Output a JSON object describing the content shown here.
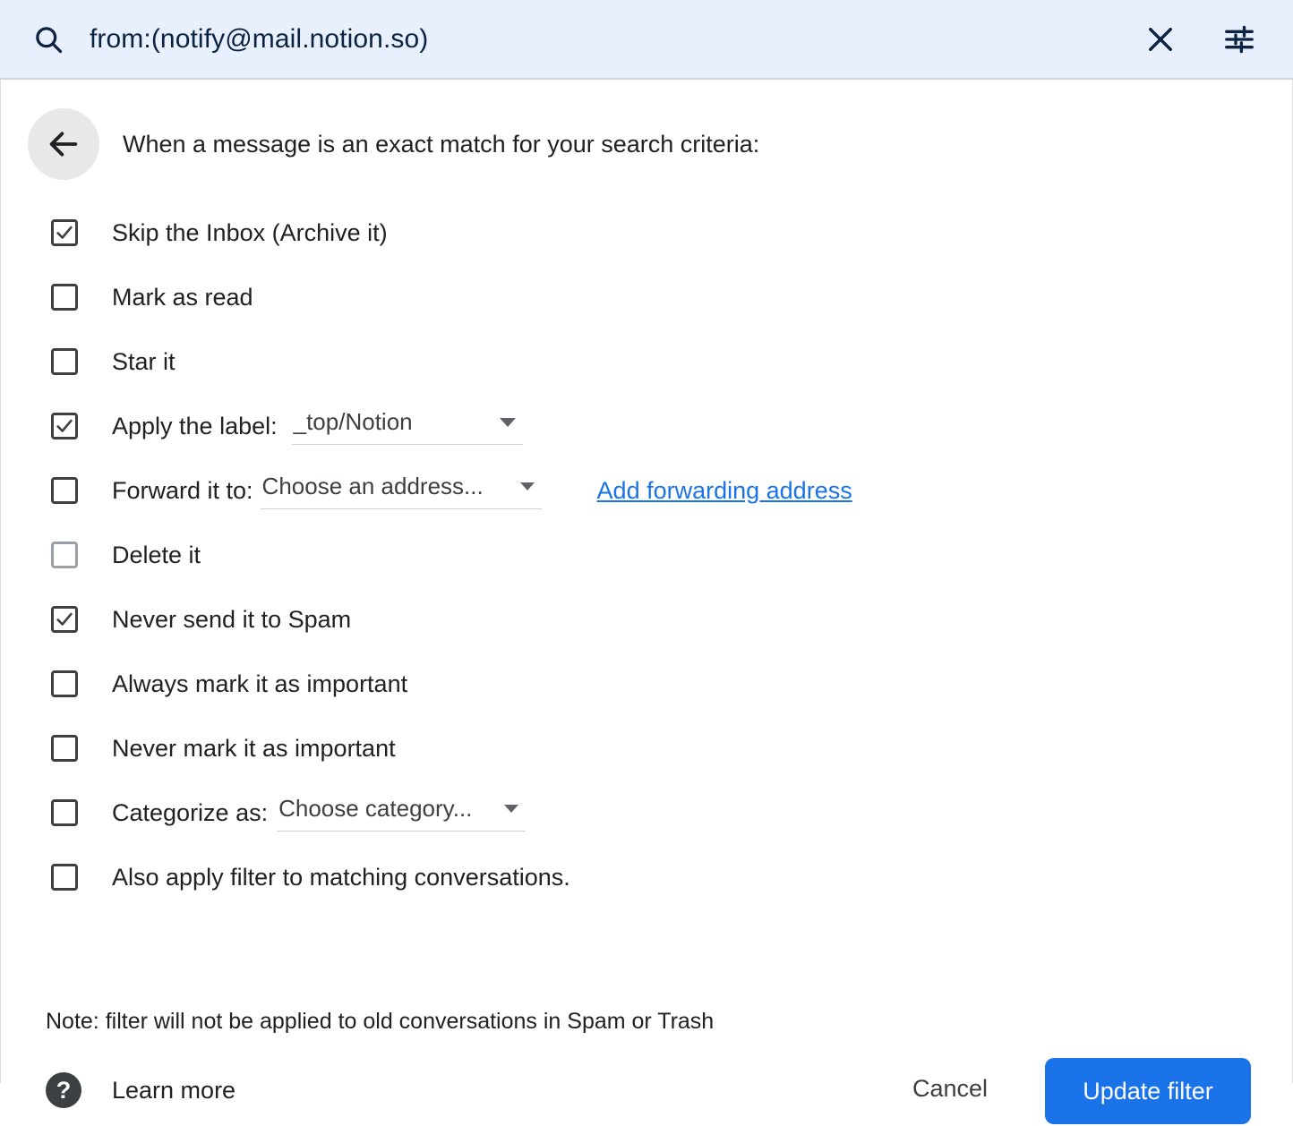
{
  "search": {
    "icon": "search-icon",
    "query": "from:(notify@mail.notion.so)",
    "clear_icon": "close-icon",
    "options_icon": "tune-icon"
  },
  "dialog": {
    "back_icon": "arrow-back-icon",
    "title": "When a message is an exact match for your search criteria:",
    "options": [
      {
        "label": "Skip the Inbox (Archive it)",
        "checked": true,
        "disabled": false
      },
      {
        "label": "Mark as read",
        "checked": false,
        "disabled": false
      },
      {
        "label": "Star it",
        "checked": false,
        "disabled": false
      },
      {
        "label": "Apply the label:",
        "checked": true,
        "disabled": false,
        "dropdown": "_top/Notion"
      },
      {
        "label": "Forward it to:",
        "checked": false,
        "disabled": false,
        "dropdown": "Choose an address...",
        "link": "Add forwarding address"
      },
      {
        "label": "Delete it",
        "checked": false,
        "disabled": true
      },
      {
        "label": "Never send it to Spam",
        "checked": true,
        "disabled": false
      },
      {
        "label": "Always mark it as important",
        "checked": false,
        "disabled": false
      },
      {
        "label": "Never mark it as important",
        "checked": false,
        "disabled": false
      },
      {
        "label": "Categorize as:",
        "checked": false,
        "disabled": false,
        "dropdown": "Choose category..."
      },
      {
        "label": "Also apply filter to matching conversations.",
        "checked": false,
        "disabled": false
      }
    ],
    "note": "Note: filter will not be applied to old conversations in Spam or Trash",
    "help_icon": "help-icon",
    "help_glyph": "?",
    "learn_more": "Learn more",
    "cancel_label": "Cancel",
    "submit_label": "Update filter"
  },
  "colors": {
    "search_bar_bg": "#e8f0fe",
    "accent_blue": "#1a73e8",
    "text_primary": "#202124",
    "checkbox_border": "#3c4043",
    "checkbox_disabled": "#9aa0a6"
  }
}
